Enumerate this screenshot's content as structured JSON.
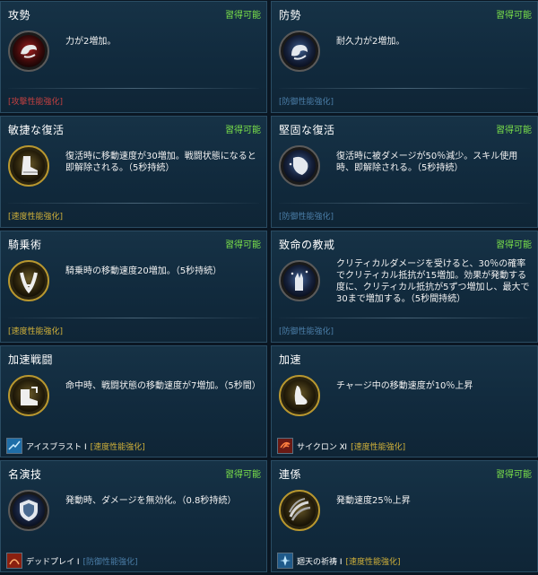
{
  "status_label": "習得可能",
  "cards": [
    {
      "title": "攻勢",
      "desc": "力が2増加。",
      "category": "[攻撃性能強化]",
      "icon": "red-fist-icon"
    },
    {
      "title": "防勢",
      "desc": "耐久力が2増加。",
      "category": "[防御性能強化]",
      "icon": "blue-fist-icon"
    },
    {
      "title": "敏捷な復活",
      "desc": "復活時に移動速度が30増加。戦闘状態になると即解除される。（5秒持続）",
      "category": "[速度性能強化]",
      "icon": "boot-icon"
    },
    {
      "title": "堅固な復活",
      "desc": "復活時に被ダメージが50％減少。スキル使用時、即解除される。（5秒持続）",
      "category": "[防御性能強化]",
      "icon": "shield-fist-icon"
    },
    {
      "title": "騎乗術",
      "desc": "騎乗時の移動速度20増加。（5秒持続）",
      "category": "[速度性能強化]",
      "icon": "horseshoe-icon"
    },
    {
      "title": "致命の教戒",
      "desc": "クリティカルダメージを受けると、30％の確率でクリティカル抵抗が15増加。効果が発動する度に、クリティカル抵抗が5ずつ増加し、最大で30まで増加する。（5秒間持続）",
      "category": "[防御性能強化]",
      "icon": "hand-sparkle-icon"
    },
    {
      "title": "加速戦闘",
      "desc": "命中時、戦闘状態の移動速度が7増加。（5秒間）",
      "skill_name": "アイスブラスト Ⅰ",
      "skill_category": "[速度性能強化]",
      "skill_icon": "ice-blast-icon",
      "icon": "gold-boot-icon"
    },
    {
      "title": "加速",
      "desc": "チャージ中の移動速度が10％上昇",
      "skill_name": "サイクロン Ⅺ",
      "skill_category": "[速度性能強化]",
      "skill_icon": "cyclone-icon",
      "icon": "foot-icon"
    },
    {
      "title": "名演技",
      "desc": "発動時、ダメージを無効化。（0.8秒持続）",
      "skill_name": "デッドプレイ Ⅰ",
      "skill_category": "[防御性能強化]",
      "skill_icon": "dead-play-icon",
      "icon": "shield-icon"
    },
    {
      "title": "連係",
      "desc": "発動速度25％上昇",
      "skill_name": "廻天の祈祷 Ⅰ",
      "skill_category": "[速度性能強化]",
      "skill_icon": "prayer-icon",
      "icon": "claw-icon"
    }
  ],
  "colors": {
    "status_green": "#7be24a",
    "attack_red": "#c24040",
    "defense_blue": "#4b7ea8",
    "speed_gold": "#d1b13a",
    "card_bg": "#133044",
    "page_bg": "#0a1622"
  }
}
